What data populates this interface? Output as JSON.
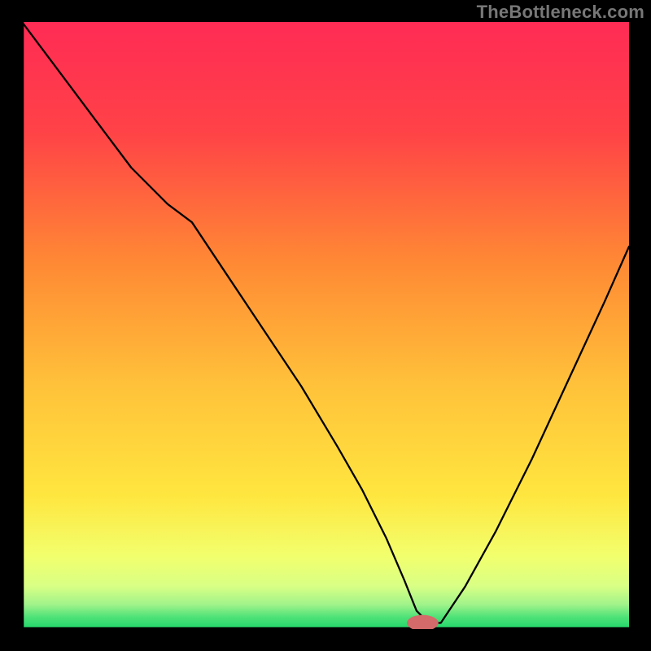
{
  "watermark": "TheBottleneck.com",
  "chart_data": {
    "type": "line",
    "title": "",
    "xlabel": "",
    "ylabel": "",
    "xlim": [
      0,
      100
    ],
    "ylim": [
      0,
      100
    ],
    "grid": false,
    "legend": false,
    "colors": {
      "gradient_top": "#ff2b55",
      "gradient_mid": "#ffd23a",
      "gradient_low": "#f7ff8a",
      "gradient_bottom": "#1fd66a",
      "curve": "#000000",
      "marker": "#d46a6a"
    },
    "series": [
      {
        "name": "bottleneck-curve",
        "x": [
          0,
          6,
          12,
          18,
          24,
          28,
          34,
          40,
          46,
          52,
          56,
          60,
          63,
          65,
          67,
          69,
          73,
          78,
          84,
          90,
          96,
          100
        ],
        "y": [
          100,
          92,
          84,
          76,
          70,
          67,
          58,
          49,
          40,
          30,
          23,
          15,
          8,
          3,
          1,
          1,
          7,
          16,
          28,
          41,
          54,
          63
        ]
      }
    ],
    "marker": {
      "x": 66,
      "y": 1,
      "rx": 2.6,
      "ry": 1.3
    },
    "note": "Values are percentages of the visible plot rectangle; x rightward, y upward from the green baseline."
  }
}
